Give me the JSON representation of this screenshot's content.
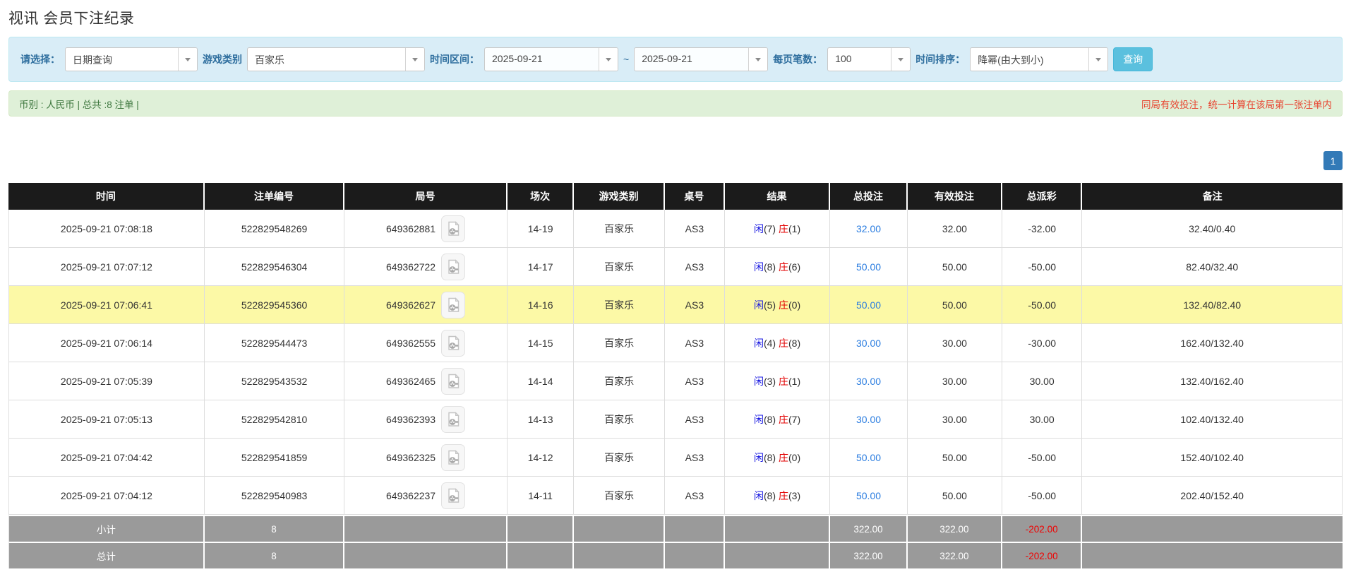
{
  "page": {
    "title": "视讯 会员下注纪录"
  },
  "filters": {
    "select_label": "请选择：",
    "select_value": "日期查询",
    "game_type_label": "游戏类别",
    "game_type_value": "百家乐",
    "time_range_label": "时间区间：",
    "date_from": "2025-09-21",
    "date_separator": "~",
    "date_to": "2025-09-21",
    "page_size_label": "每页笔数：",
    "page_size_value": "100",
    "sort_label": "时间排序：",
    "sort_value": "降幂(由大到小)",
    "search_button_label": "查询"
  },
  "summary": {
    "left_text": "币别 : 人民币 | 总共 :8 注单 |",
    "right_note": "同局有效投注，统一计算在该局第一张注单内"
  },
  "pagination": {
    "current_page": "1"
  },
  "icons": {
    "dropdown": "caret-down-icon",
    "round_video": "video-replay-icon"
  },
  "colors": {
    "filter_bar_bg": "#d9edf7",
    "summary_bar_bg": "#dff0d8",
    "summary_text_green": "#3c763d",
    "note_red": "#e8432f",
    "header_bg": "#1b1b1b",
    "footer_bg": "#9a9a9a",
    "highlight_row": "#fcf9a6",
    "player_blue": "#1515e0",
    "banker_red": "#e30000",
    "link_blue": "#2b7de0",
    "pagination_blue": "#337ab7",
    "search_button_bg": "#5bc0de"
  },
  "table": {
    "headers": [
      "时间",
      "注单编号",
      "局号",
      "场次",
      "游戏类别",
      "桌号",
      "结果",
      "总投注",
      "有效投注",
      "总派彩",
      "备注"
    ],
    "result_player_label": "闲",
    "result_banker_label": "庄",
    "rows": [
      {
        "time": "2025-09-21 07:08:18",
        "bet_id": "522829548269",
        "round_id": "649362881",
        "session": "14-19",
        "game": "百家乐",
        "table_no": "AS3",
        "player": "7",
        "banker": "1",
        "total_bet": "32.00",
        "valid_bet": "32.00",
        "payout": "-32.00",
        "note": "32.40/0.40",
        "highlight": false
      },
      {
        "time": "2025-09-21 07:07:12",
        "bet_id": "522829546304",
        "round_id": "649362722",
        "session": "14-17",
        "game": "百家乐",
        "table_no": "AS3",
        "player": "8",
        "banker": "6",
        "total_bet": "50.00",
        "valid_bet": "50.00",
        "payout": "-50.00",
        "note": "82.40/32.40",
        "highlight": false
      },
      {
        "time": "2025-09-21 07:06:41",
        "bet_id": "522829545360",
        "round_id": "649362627",
        "session": "14-16",
        "game": "百家乐",
        "table_no": "AS3",
        "player": "5",
        "banker": "0",
        "total_bet": "50.00",
        "valid_bet": "50.00",
        "payout": "-50.00",
        "note": "132.40/82.40",
        "highlight": true
      },
      {
        "time": "2025-09-21 07:06:14",
        "bet_id": "522829544473",
        "round_id": "649362555",
        "session": "14-15",
        "game": "百家乐",
        "table_no": "AS3",
        "player": "4",
        "banker": "8",
        "total_bet": "30.00",
        "valid_bet": "30.00",
        "payout": "-30.00",
        "note": "162.40/132.40",
        "highlight": false
      },
      {
        "time": "2025-09-21 07:05:39",
        "bet_id": "522829543532",
        "round_id": "649362465",
        "session": "14-14",
        "game": "百家乐",
        "table_no": "AS3",
        "player": "3",
        "banker": "1",
        "total_bet": "30.00",
        "valid_bet": "30.00",
        "payout": "30.00",
        "note": "132.40/162.40",
        "highlight": false
      },
      {
        "time": "2025-09-21 07:05:13",
        "bet_id": "522829542810",
        "round_id": "649362393",
        "session": "14-13",
        "game": "百家乐",
        "table_no": "AS3",
        "player": "8",
        "banker": "7",
        "total_bet": "30.00",
        "valid_bet": "30.00",
        "payout": "30.00",
        "note": "102.40/132.40",
        "highlight": false
      },
      {
        "time": "2025-09-21 07:04:42",
        "bet_id": "522829541859",
        "round_id": "649362325",
        "session": "14-12",
        "game": "百家乐",
        "table_no": "AS3",
        "player": "8",
        "banker": "0",
        "total_bet": "50.00",
        "valid_bet": "50.00",
        "payout": "-50.00",
        "note": "152.40/102.40",
        "highlight": false
      },
      {
        "time": "2025-09-21 07:04:12",
        "bet_id": "522829540983",
        "round_id": "649362237",
        "session": "14-11",
        "game": "百家乐",
        "table_no": "AS3",
        "player": "8",
        "banker": "3",
        "total_bet": "50.00",
        "valid_bet": "50.00",
        "payout": "-50.00",
        "note": "202.40/152.40",
        "highlight": false
      }
    ],
    "footer": [
      {
        "label": "小计",
        "count": "8",
        "total_bet": "322.00",
        "valid_bet": "322.00",
        "payout": "-202.00"
      },
      {
        "label": "总计",
        "count": "8",
        "total_bet": "322.00",
        "valid_bet": "322.00",
        "payout": "-202.00"
      }
    ]
  }
}
